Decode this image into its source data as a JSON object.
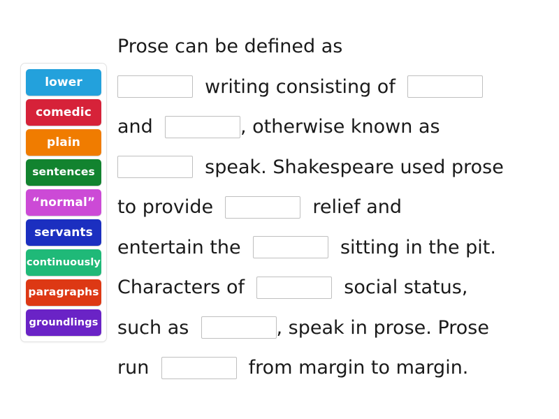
{
  "word_bank": {
    "name": "word-bank",
    "tiles": [
      {
        "label": "lower",
        "color": "#23a1dc"
      },
      {
        "label": "comedic",
        "color": "#d62239"
      },
      {
        "label": "plain",
        "color": "#f07c00"
      },
      {
        "label": "sentences",
        "color": "#12832f"
      },
      {
        "label": "“normal”",
        "color": "#cc4ad6"
      },
      {
        "label": "servants",
        "color": "#1b2fc0"
      },
      {
        "label": "continuously",
        "color": "#1fb978"
      },
      {
        "label": "paragraphs",
        "color": "#dd3814"
      },
      {
        "label": "groundlings",
        "color": "#6a23c6"
      }
    ]
  },
  "cloze": {
    "lines": [
      {
        "parts": [
          {
            "type": "text",
            "value": "Prose can be defined as"
          }
        ]
      },
      {
        "parts": [
          {
            "type": "blank",
            "value": ""
          },
          {
            "type": "text",
            "value": "  writing consisting of  "
          },
          {
            "type": "blank",
            "value": ""
          }
        ]
      },
      {
        "parts": [
          {
            "type": "text",
            "value": "and  "
          },
          {
            "type": "blank",
            "value": ""
          },
          {
            "type": "text",
            "value": ", otherwise known as"
          }
        ]
      },
      {
        "parts": [
          {
            "type": "blank",
            "value": ""
          },
          {
            "type": "text",
            "value": "  speak. Shakespeare used prose"
          }
        ]
      },
      {
        "parts": [
          {
            "type": "text",
            "value": "to provide  "
          },
          {
            "type": "blank",
            "value": ""
          },
          {
            "type": "text",
            "value": "  relief and"
          }
        ]
      },
      {
        "parts": [
          {
            "type": "text",
            "value": "entertain the  "
          },
          {
            "type": "blank",
            "value": ""
          },
          {
            "type": "text",
            "value": "  sitting in the pit."
          }
        ]
      },
      {
        "parts": [
          {
            "type": "text",
            "value": "Characters of  "
          },
          {
            "type": "blank",
            "value": ""
          },
          {
            "type": "text",
            "value": "  social status,"
          }
        ]
      },
      {
        "parts": [
          {
            "type": "text",
            "value": "such as  "
          },
          {
            "type": "blank",
            "value": ""
          },
          {
            "type": "text",
            "value": ", speak in prose. Prose"
          }
        ]
      },
      {
        "parts": [
          {
            "type": "text",
            "value": "run  "
          },
          {
            "type": "blank",
            "value": ""
          },
          {
            "type": "text",
            "value": "  from margin to margin."
          }
        ]
      }
    ]
  }
}
